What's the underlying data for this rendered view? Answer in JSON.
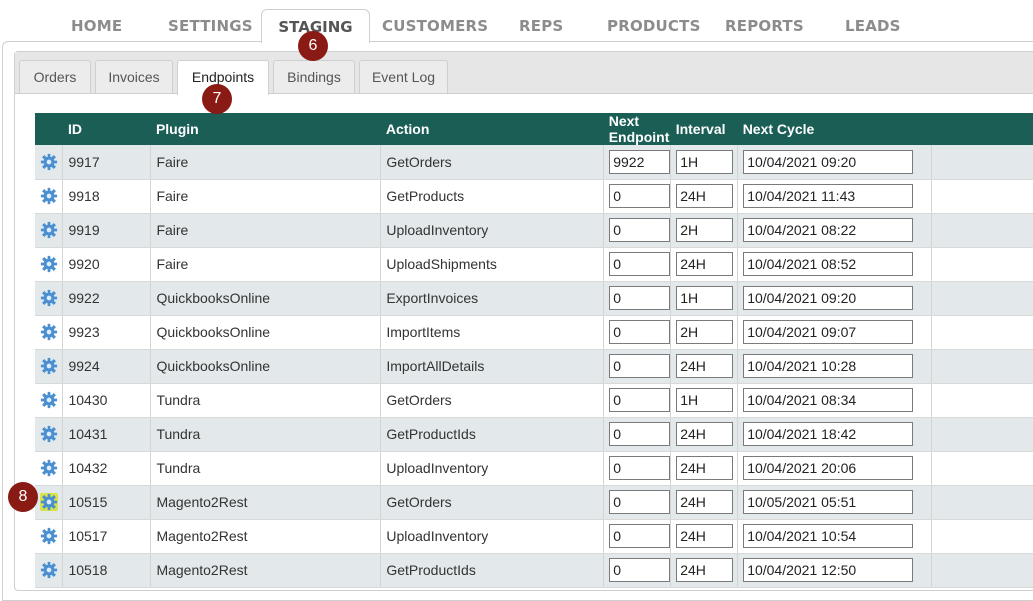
{
  "nav": {
    "items": [
      "HOME",
      "SETTINGS",
      "STAGING",
      "CUSTOMERS",
      "REPS",
      "PRODUCTS",
      "REPORTS",
      "LEADS"
    ],
    "active": "STAGING"
  },
  "subtabs": {
    "items": [
      "Orders",
      "Invoices",
      "Endpoints",
      "Bindings",
      "Event Log"
    ],
    "active": "Endpoints"
  },
  "table": {
    "headers": [
      "ID",
      "Plugin",
      "Action",
      "Next Endpoint",
      "Interval",
      "Next Cycle"
    ],
    "rows": [
      {
        "id": "9917",
        "plugin": "Faire",
        "action": "GetOrders",
        "next_endpoint": "9922",
        "interval": "1H",
        "next_cycle": "10/04/2021 09:20"
      },
      {
        "id": "9918",
        "plugin": "Faire",
        "action": "GetProducts",
        "next_endpoint": "0",
        "interval": "24H",
        "next_cycle": "10/04/2021 11:43"
      },
      {
        "id": "9919",
        "plugin": "Faire",
        "action": "UploadInventory",
        "next_endpoint": "0",
        "interval": "2H",
        "next_cycle": "10/04/2021 08:22"
      },
      {
        "id": "9920",
        "plugin": "Faire",
        "action": "UploadShipments",
        "next_endpoint": "0",
        "interval": "24H",
        "next_cycle": "10/04/2021 08:52"
      },
      {
        "id": "9922",
        "plugin": "QuickbooksOnline",
        "action": "ExportInvoices",
        "next_endpoint": "0",
        "interval": "1H",
        "next_cycle": "10/04/2021 09:20"
      },
      {
        "id": "9923",
        "plugin": "QuickbooksOnline",
        "action": "ImportItems",
        "next_endpoint": "0",
        "interval": "2H",
        "next_cycle": "10/04/2021 09:07"
      },
      {
        "id": "9924",
        "plugin": "QuickbooksOnline",
        "action": "ImportAllDetails",
        "next_endpoint": "0",
        "interval": "24H",
        "next_cycle": "10/04/2021 10:28"
      },
      {
        "id": "10430",
        "plugin": "Tundra",
        "action": "GetOrders",
        "next_endpoint": "0",
        "interval": "1H",
        "next_cycle": "10/04/2021 08:34"
      },
      {
        "id": "10431",
        "plugin": "Tundra",
        "action": "GetProductIds",
        "next_endpoint": "0",
        "interval": "24H",
        "next_cycle": "10/04/2021 18:42"
      },
      {
        "id": "10432",
        "plugin": "Tundra",
        "action": "UploadInventory",
        "next_endpoint": "0",
        "interval": "24H",
        "next_cycle": "10/04/2021 20:06"
      },
      {
        "id": "10515",
        "plugin": "Magento2Rest",
        "action": "GetOrders",
        "next_endpoint": "0",
        "interval": "24H",
        "next_cycle": "10/05/2021 05:51",
        "highlight": true
      },
      {
        "id": "10517",
        "plugin": "Magento2Rest",
        "action": "UploadInventory",
        "next_endpoint": "0",
        "interval": "24H",
        "next_cycle": "10/04/2021 10:54"
      },
      {
        "id": "10518",
        "plugin": "Magento2Rest",
        "action": "GetProductIds",
        "next_endpoint": "0",
        "interval": "24H",
        "next_cycle": "10/04/2021 12:50"
      }
    ]
  },
  "badges": [
    "6",
    "7",
    "8"
  ],
  "colors": {
    "header": "#1b5e56",
    "row_alt": "#e3e9eb",
    "badge": "#8a1a14",
    "highlight": "#d8e34a",
    "gear": "#4a8fd0"
  },
  "icons": {
    "row_action": "gear-icon"
  }
}
